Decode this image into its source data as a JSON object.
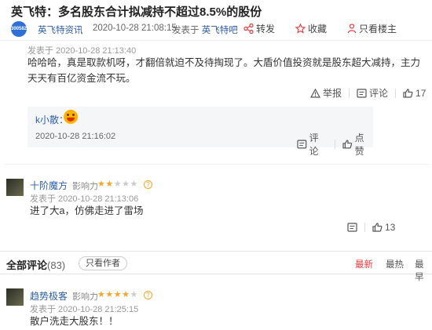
{
  "page": {
    "title": "英飞特：多名股东合计拟减持不超过8.5%的股份",
    "logo_text": "300582",
    "source": "英飞特资讯",
    "publish_time": "2020-10-28 21:08:15",
    "published_in_prefix": "发表于",
    "published_in_bar": "英飞特吧",
    "share_label": "转发",
    "favorite_label": "收藏",
    "author_only_label": "只看楼主"
  },
  "comment1": {
    "time": "发表于 2020-10-28 21:13:40",
    "text": "哈哈哈，真是取款机呀，才翻倍就迫不及待掏现了。大盾价值投资就是股东超大减持，主力天天有百亿资金流不玩。",
    "report_label": "举报",
    "comment_label": "评论",
    "likes": "17"
  },
  "reply": {
    "name": "k小散：",
    "time": "2020-10-28 21:16:02",
    "comment_label": "评论",
    "like_label": "点赞"
  },
  "comment2": {
    "username": "十阶魔方",
    "influence_label": "影响力",
    "stars_on": 2,
    "stars_total": 5,
    "time": "发表于 2020-10-28 21:13:06",
    "text": "进了大a，仿佛走进了雷场",
    "likes": "13"
  },
  "all_comments": {
    "title": "全部评论",
    "count": "(83)",
    "author_only": "只看作者",
    "sort_latest": "最新",
    "sort_hot": "最热",
    "sort_earliest": "最早"
  },
  "comment3": {
    "username": "趋势极客",
    "influence_label": "影响力",
    "stars_on": 4,
    "stars_total": 5,
    "time": "发表于 2020-10-28 21:25:15",
    "text": "散户洗走大股东！！"
  },
  "colors": {
    "link": "#2e5ea8",
    "star": "#f5a623",
    "active_sort": "#e4393c"
  }
}
